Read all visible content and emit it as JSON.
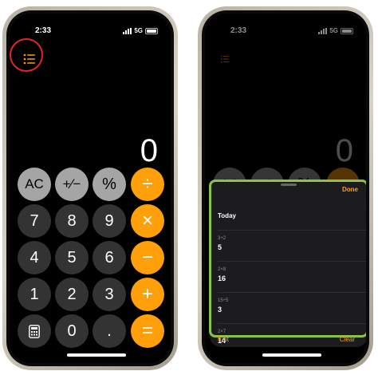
{
  "left_phone": {
    "status": {
      "time": "2:33",
      "network": "5G"
    },
    "display": "0",
    "keypad": [
      {
        "label": "AC",
        "style": "gray-light"
      },
      {
        "label": "+⁄−",
        "style": "gray-light"
      },
      {
        "label": "%",
        "style": "gray-light"
      },
      {
        "label": "÷",
        "style": "orange"
      },
      {
        "label": "7",
        "style": "gray-dark"
      },
      {
        "label": "8",
        "style": "gray-dark"
      },
      {
        "label": "9",
        "style": "gray-dark"
      },
      {
        "label": "×",
        "style": "orange"
      },
      {
        "label": "4",
        "style": "gray-dark"
      },
      {
        "label": "5",
        "style": "gray-dark"
      },
      {
        "label": "6",
        "style": "gray-dark"
      },
      {
        "label": "−",
        "style": "orange"
      },
      {
        "label": "1",
        "style": "gray-dark"
      },
      {
        "label": "2",
        "style": "gray-dark"
      },
      {
        "label": "3",
        "style": "gray-dark"
      },
      {
        "label": "+",
        "style": "orange"
      },
      {
        "label": "calculator-icon",
        "style": "gray-dark"
      },
      {
        "label": "0",
        "style": "gray-dark"
      },
      {
        "label": ".",
        "style": "gray-dark"
      },
      {
        "label": "=",
        "style": "orange"
      }
    ],
    "history_icon": "list-icon",
    "highlight_color": "#e22626"
  },
  "right_phone": {
    "status": {
      "time": "2:33",
      "network": "5G"
    },
    "display": "0",
    "history_icon": "list-icon",
    "history_sheet": {
      "done_label": "Done",
      "section": "Today",
      "entries": [
        {
          "expression": "3+2",
          "result": "5"
        },
        {
          "expression": "2×8",
          "result": "16"
        },
        {
          "expression": "15÷5",
          "result": "3"
        },
        {
          "expression": "2×7",
          "result": "14"
        }
      ],
      "edit_label": "Edit",
      "clear_label": "Clear"
    },
    "highlight_color": "#8bc34a"
  },
  "colors": {
    "accent": "#ff9f0a",
    "key_light": "#a5a5a5",
    "key_dark": "#333333"
  }
}
